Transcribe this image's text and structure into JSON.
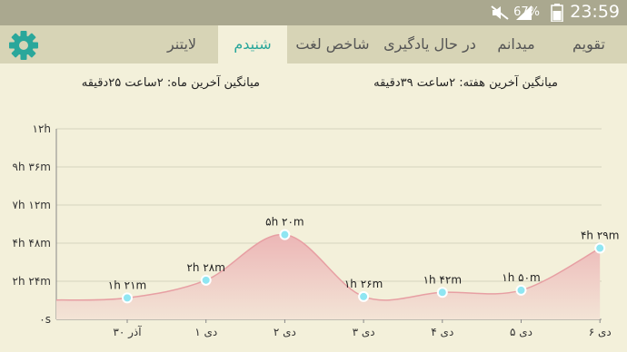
{
  "status_bar": {
    "battery_percent": "67%",
    "time": "23:59",
    "icons": [
      "mute-icon",
      "signal-icon",
      "battery-icon"
    ]
  },
  "tabs": [
    {
      "label": "تقویم",
      "active": false
    },
    {
      "label": "میدانم",
      "active": false
    },
    {
      "label": "در حال یادگیری",
      "active": false
    },
    {
      "label": "شاخص لغت",
      "active": false
    },
    {
      "label": "شنیدم",
      "active": true
    },
    {
      "label": "لایتنر",
      "active": false
    }
  ],
  "settings_icon": "gear-icon",
  "accent_color": "#2aa79b",
  "summary": {
    "weekly_average": "میانگین آخرین هفته: ۲ساعت ۳۹دقیقه",
    "monthly_average": "میانگین آخرین ماه: ۲ساعت ۲۵دقیقه"
  },
  "chart_data": {
    "type": "area",
    "y_ticks": [
      "۱۲h",
      "۹h ۳۶m",
      "۷h ۱۲m",
      "۴h ۴۸m",
      "۲h ۲۴m",
      "۰s"
    ],
    "ylim_minutes": [
      0,
      720
    ],
    "categories": [
      "۳۰ آذر",
      "۱ دی",
      "۲ دی",
      "۳ دی",
      "۴ دی",
      "۵ دی",
      "۶ دی"
    ],
    "values_minutes": [
      81,
      148,
      320,
      86,
      102,
      110,
      269
    ],
    "value_labels": [
      "۱h ۲۱m",
      "۲h ۲۸m",
      "۵h ۲۰m",
      "۱h ۲۶m",
      "۱h ۴۲m",
      "۱h ۵۰m",
      "۴h ۲۹m"
    ],
    "fill_color": "#ecb6b6",
    "line_color": "#e79fa3",
    "marker_color": "#8fe6f2",
    "grid": true
  }
}
